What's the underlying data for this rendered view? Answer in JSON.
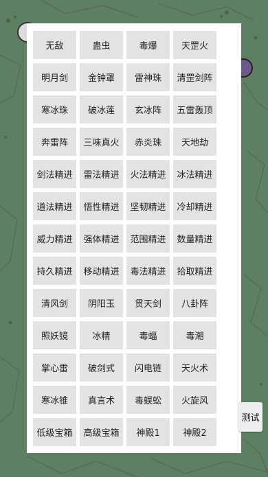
{
  "menu": {
    "items": [
      [
        "无敌",
        "蛊虫",
        "毒爆",
        "天罡火"
      ],
      [
        "明月剑",
        "金钟罩",
        "雷神珠",
        "清罡剑阵"
      ],
      [
        "寒冰珠",
        "破冰莲",
        "玄冰阵",
        "五雷轰顶"
      ],
      [
        "奔雷阵",
        "三味真火",
        "赤炎珠",
        "天地劫"
      ],
      [
        "剑法精进",
        "雷法精进",
        "火法精进",
        "冰法精进"
      ],
      [
        "道法精进",
        "悟性精进",
        "坚韧精进",
        "冷却精进"
      ],
      [
        "威力精进",
        "强体精进",
        "范围精进",
        "数量精进"
      ],
      [
        "持久精进",
        "移动精进",
        "毒法精进",
        "拾取精进"
      ],
      [
        "清风剑",
        "阴阳玉",
        "贯天剑",
        "八卦阵"
      ],
      [
        "照妖镜",
        "冰精",
        "毒蝠",
        "毒潮"
      ],
      [
        "掌心雷",
        "破剑式",
        "闪电链",
        "天火术"
      ],
      [
        "寒冰锥",
        "真言术",
        "毒蜈蚣",
        "火旋风"
      ],
      [
        "低级宝箱",
        "高级宝箱",
        "神殿1",
        "神殿2"
      ]
    ]
  },
  "test_button": {
    "label": "测试"
  },
  "colors": {
    "background": "#5f7f63",
    "panel": "#ffffff",
    "cell": "#e3e3e3"
  }
}
